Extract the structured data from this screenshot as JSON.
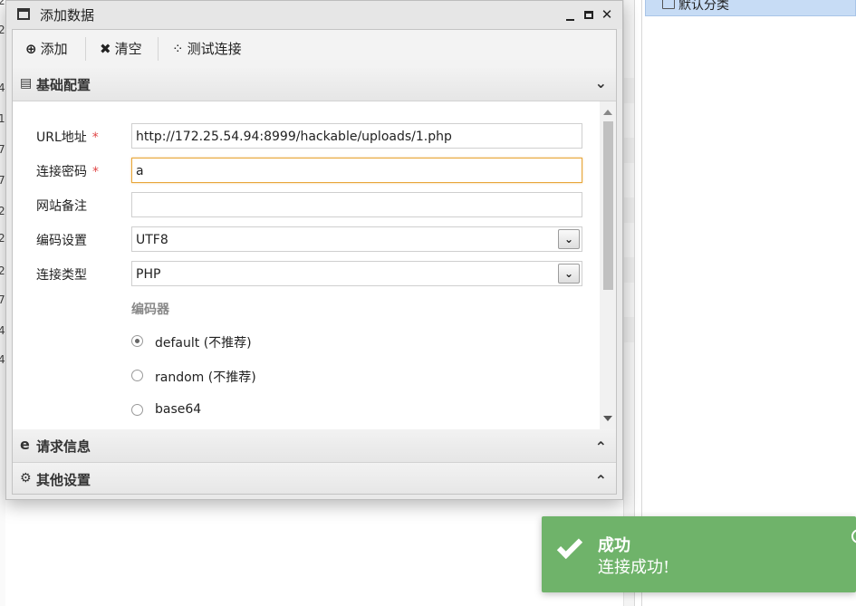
{
  "background": {
    "left_digits": [
      "2",
      "2",
      "4",
      "1",
      "7",
      "7",
      "2",
      "2",
      "2",
      "7",
      "4",
      "4"
    ],
    "tree": {
      "selected_label": "默认分类"
    }
  },
  "dialog": {
    "title": "添加数据",
    "window_buttons": {
      "minimize": "_",
      "close": "✕"
    },
    "toolbar": {
      "add_label": "添加",
      "clear_label": "清空",
      "test_label": "测试连接"
    },
    "sections": {
      "basic": "基础配置",
      "request": "请求信息",
      "other": "其他设置"
    },
    "form": {
      "url": {
        "label": "URL地址",
        "required": "*",
        "value": "http://172.25.54.94:8999/hackable/uploads/1.php"
      },
      "password": {
        "label": "连接密码",
        "required": "*",
        "value": "a"
      },
      "note": {
        "label": "网站备注",
        "value": ""
      },
      "encoding": {
        "label": "编码设置",
        "value": "UTF8"
      },
      "conn_type": {
        "label": "连接类型",
        "value": "PHP"
      },
      "encoder": {
        "title": "编码器",
        "options": [
          {
            "label": "default (不推荐)",
            "checked": true
          },
          {
            "label": "random (不推荐)",
            "checked": false
          },
          {
            "label": "base64",
            "checked": false
          }
        ]
      }
    }
  },
  "toast": {
    "title": "成功",
    "message": "连接成功!",
    "color": "#6fb36a"
  }
}
